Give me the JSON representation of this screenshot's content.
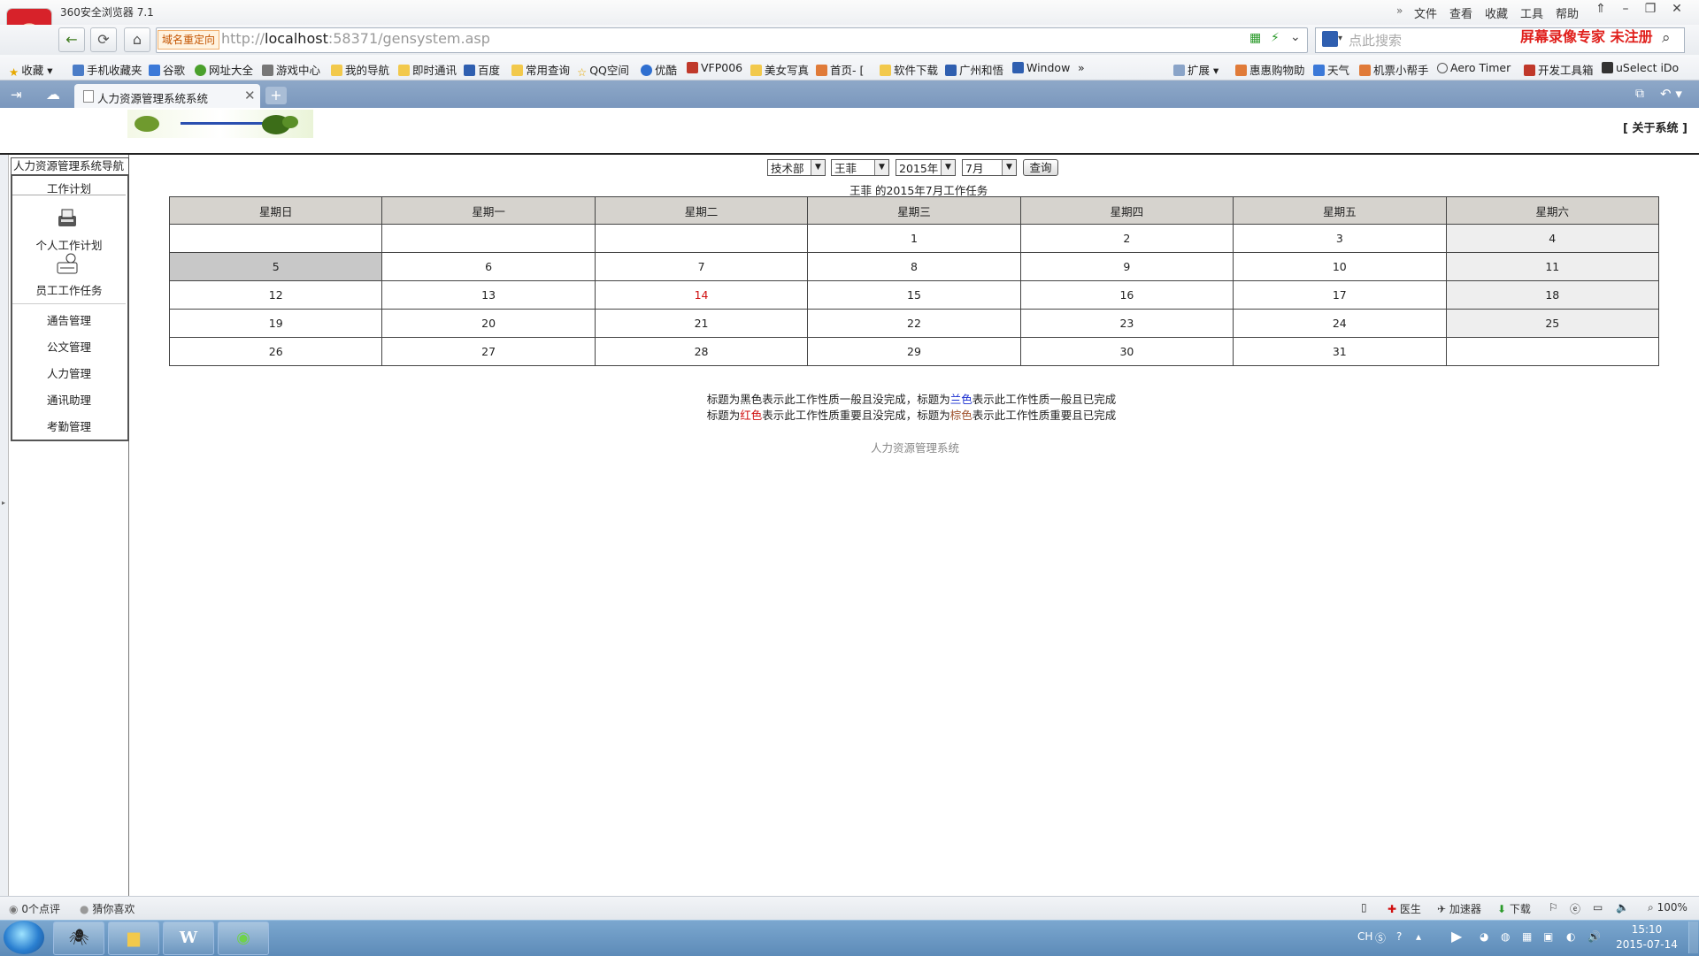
{
  "browser": {
    "app_title": "360安全浏览器 7.1",
    "menu": [
      "文件",
      "查看",
      "收藏",
      "工具",
      "帮助"
    ],
    "redirect_tag": "域名重定向",
    "url_prefix": "http://",
    "url_host": "localhost",
    "url_rest": ":58371/gensystem.asp",
    "search_placeholder": "点此搜索",
    "recorder_watermark": "屏幕录像专家  未注册",
    "bookmarks": [
      "收藏",
      "手机收藏夹",
      "谷歌",
      "网址大全",
      "游戏中心",
      "我的导航",
      "即时通讯",
      "百度",
      "常用查询",
      "QQ空间",
      "优酷",
      "VFP006",
      "美女写真",
      "首页- [",
      "软件下载",
      "广州和悟",
      "Window",
      "扩展",
      "惠惠购物助",
      "天气",
      "机票小帮手",
      "Aero Timer",
      "开发工具箱",
      "uSelect iDo"
    ],
    "tab_title": "人力资源管理系统系统",
    "status_left": [
      "0个点评",
      "猜你喜欢"
    ],
    "status_right": [
      "医生",
      "加速器",
      "下载",
      "100%"
    ],
    "clock_time": "15:10",
    "clock_date": "2015-07-14",
    "tray_lang": "CH"
  },
  "header": {
    "about_link": "[ 关于系统 ]"
  },
  "nav": {
    "title": "人力资源管理系统导航",
    "section": "工作计划",
    "items": [
      "个人工作计划",
      "员工工作任务",
      "通告管理",
      "公文管理",
      "人力管理",
      "通讯助理",
      "考勤管理"
    ]
  },
  "filters": {
    "department": "技术部",
    "employee": "王菲",
    "year": "2015年",
    "month": "7月",
    "query_button": "查询"
  },
  "calendar": {
    "title": "王菲 的2015年7月工作任务",
    "weekdays": [
      "星期日",
      "星期一",
      "星期二",
      "星期三",
      "星期四",
      "星期五",
      "星期六"
    ],
    "weeks": [
      [
        "",
        "",
        "",
        "1",
        "2",
        "3",
        "4"
      ],
      [
        "5",
        "6",
        "7",
        "8",
        "9",
        "10",
        "11"
      ],
      [
        "12",
        "13",
        "14",
        "15",
        "16",
        "17",
        "18"
      ],
      [
        "19",
        "20",
        "21",
        "22",
        "23",
        "24",
        "25"
      ],
      [
        "26",
        "27",
        "28",
        "29",
        "30",
        "31",
        ""
      ]
    ],
    "today": "14"
  },
  "legend": {
    "line1_a": "标题为黑色表示此工作性质一般且没完成，标题为",
    "line1_b": "兰色",
    "line1_c": "表示此工作性质一般且已完成",
    "line2_a": "标题为",
    "line2_b": "红色",
    "line2_c": "表示此工作性质重要且没完成，标题为",
    "line2_d": "棕色",
    "line2_e": "表示此工作性质重要且已完成"
  },
  "footer": {
    "text": "人力资源管理系统"
  },
  "colors": {
    "blue": "#1a2fd0",
    "red": "#d01010",
    "brown": "#a0522d",
    "header_gray": "#d6d3ce"
  }
}
